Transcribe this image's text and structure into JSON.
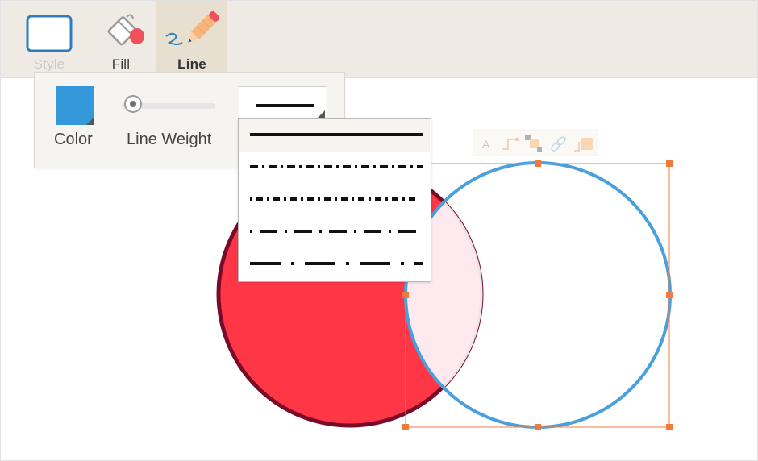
{
  "toolbar": {
    "tabs": [
      {
        "id": "style",
        "label": "Style"
      },
      {
        "id": "fill",
        "label": "Fill"
      },
      {
        "id": "line",
        "label": "Line"
      }
    ],
    "active_tab": "line"
  },
  "line_panel": {
    "color_label": "Color",
    "color_value": "#3498db",
    "weight_label": "Line Weight",
    "line_styles": [
      "solid",
      "dash-dot-dot",
      "dash-dot",
      "dot-dash-long",
      "long-dash"
    ],
    "selected_style": "solid"
  },
  "floating_toolbar": {
    "text_tool": "A",
    "icons": [
      "text-icon",
      "connector-icon",
      "arrange-icon",
      "link-icon",
      "waypoint-icon"
    ]
  },
  "shapes": {
    "red_circle": {
      "fill": "#ff3646",
      "stroke": "#7a0a2a"
    },
    "blue_circle": {
      "fill": "#ffffff",
      "stroke": "#4aa0dc"
    },
    "selection_color": "#f07a3c"
  }
}
